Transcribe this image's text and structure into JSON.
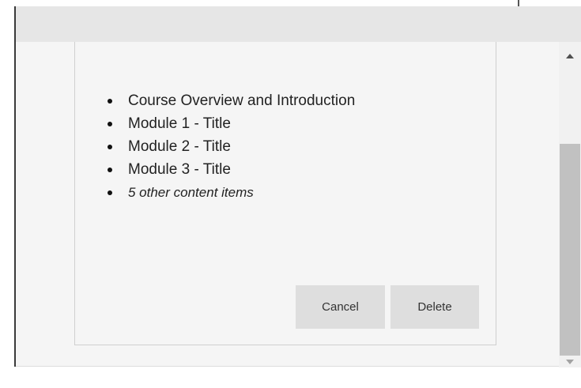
{
  "dialog": {
    "items": [
      {
        "label": "Course Overview and Introduction",
        "italic": false
      },
      {
        "label": "Module 1 - Title",
        "italic": false
      },
      {
        "label": "Module 2 - Title",
        "italic": false
      },
      {
        "label": "Module 3 - Title",
        "italic": false
      },
      {
        "label": "5 other content items",
        "italic": true
      }
    ],
    "cancel_label": "Cancel",
    "delete_label": "Delete"
  },
  "scrollbar": {
    "up_icon": "arrow-up-icon",
    "down_icon": "arrow-down-icon"
  },
  "colors": {
    "background": "#f5f5f5",
    "top_bar": "#e6e6e6",
    "button": "#dedede",
    "scroll_thumb": "#c1c1c1"
  }
}
